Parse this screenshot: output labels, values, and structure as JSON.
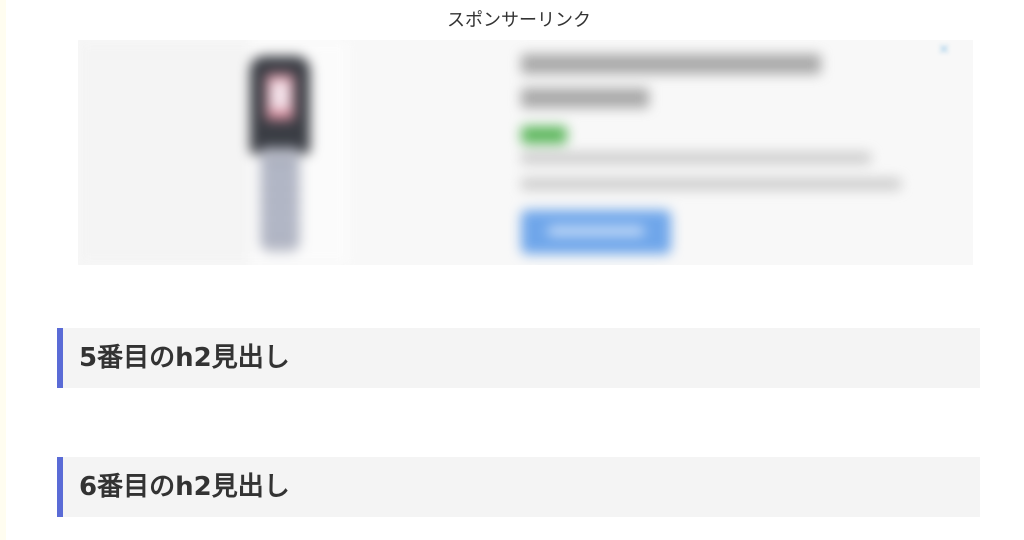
{
  "sponsor": {
    "label": "スポンサーリンク"
  },
  "headings": [
    {
      "text": "5番目のh2見出し"
    },
    {
      "text": "6番目のh2見出し"
    }
  ],
  "colors": {
    "heading_accent": "#5a6bd6",
    "heading_background": "#f4f4f4",
    "heading_text": "#333333",
    "ad_button": "#6fa6ea",
    "ad_badge": "#5fb85f"
  },
  "icons": {
    "ad_choice": "ad-choices-icon"
  }
}
